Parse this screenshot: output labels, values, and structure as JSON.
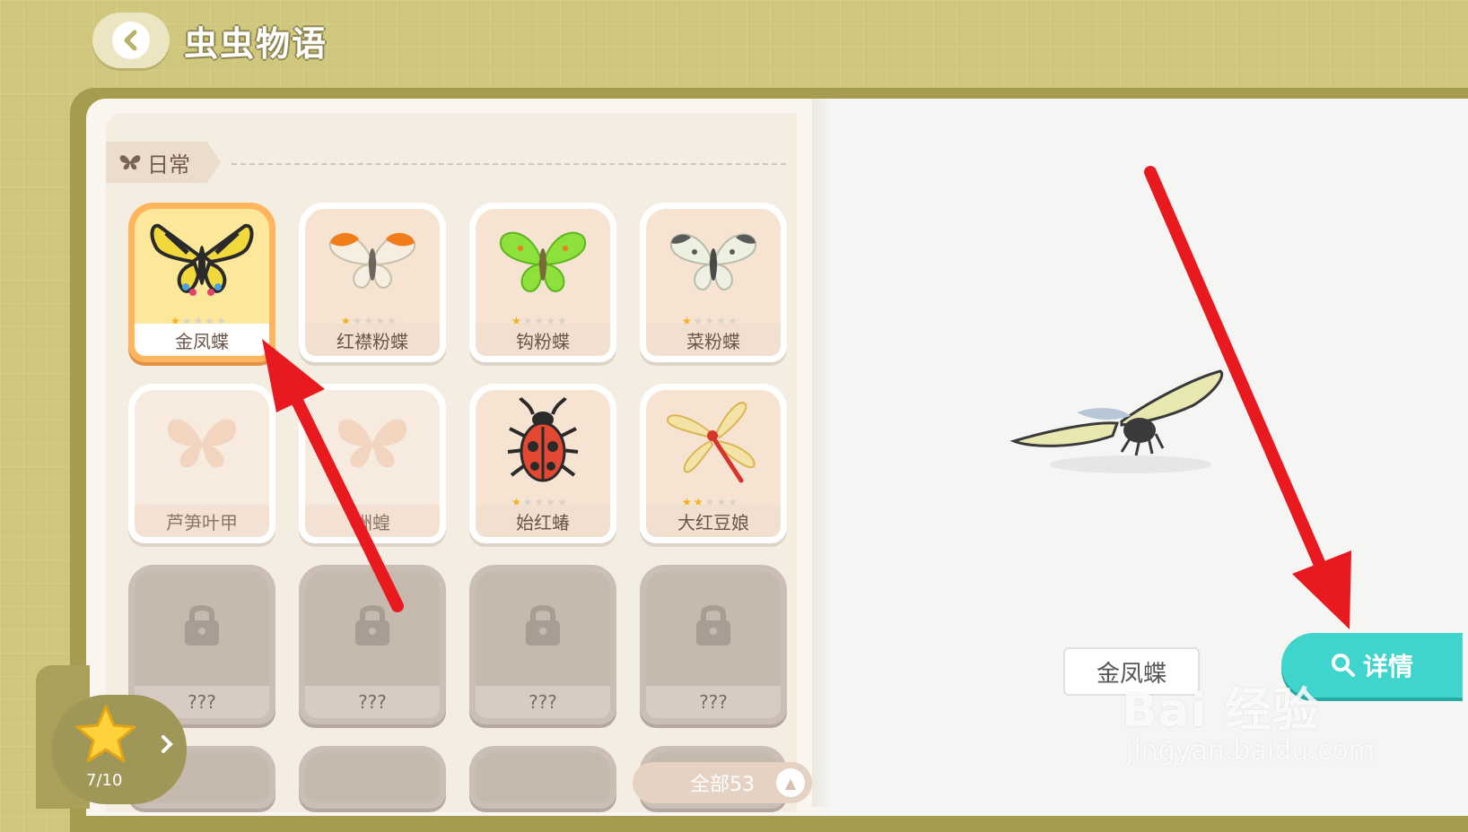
{
  "header": {
    "title": "虫虫物语"
  },
  "section": {
    "label": "日常"
  },
  "cards": [
    {
      "name": "金凤蝶",
      "stars": 1,
      "state": "selected",
      "icon": "swallowtail-butterfly"
    },
    {
      "name": "红襟粉蝶",
      "stars": 1,
      "state": "normal",
      "icon": "orange-tip-butterfly"
    },
    {
      "name": "钩粉蝶",
      "stars": 1,
      "state": "normal",
      "icon": "brimstone-butterfly"
    },
    {
      "name": "菜粉蝶",
      "stars": 1,
      "state": "normal",
      "icon": "cabbage-white-butterfly"
    },
    {
      "name": "芦笋叶甲",
      "stars": 0,
      "state": "unknown",
      "icon": "butterfly-silhouette"
    },
    {
      "name": "洲蝗",
      "stars": 0,
      "state": "unknown",
      "icon": "butterfly-silhouette"
    },
    {
      "name": "始红蝽",
      "stars": 1,
      "state": "normal",
      "icon": "firebug"
    },
    {
      "name": "大红豆娘",
      "stars": 2,
      "state": "normal",
      "icon": "red-damselfly"
    },
    {
      "name": "???",
      "state": "locked",
      "icon": "lock"
    },
    {
      "name": "???",
      "state": "locked",
      "icon": "lock"
    },
    {
      "name": "???",
      "state": "locked",
      "icon": "lock"
    },
    {
      "name": "???",
      "state": "locked",
      "icon": "lock"
    }
  ],
  "progress": {
    "text": "7/10",
    "icon": "star"
  },
  "filter": {
    "label": "全部53"
  },
  "preview": {
    "name": "金凤蝶",
    "detail_label": "详情"
  },
  "watermark": {
    "brand": "Bai 经验",
    "url": "jingyan.baidu.com"
  },
  "colors": {
    "accent": "#3fd4cc",
    "selected": "#ffb45e",
    "annotation": "#e8191f"
  }
}
